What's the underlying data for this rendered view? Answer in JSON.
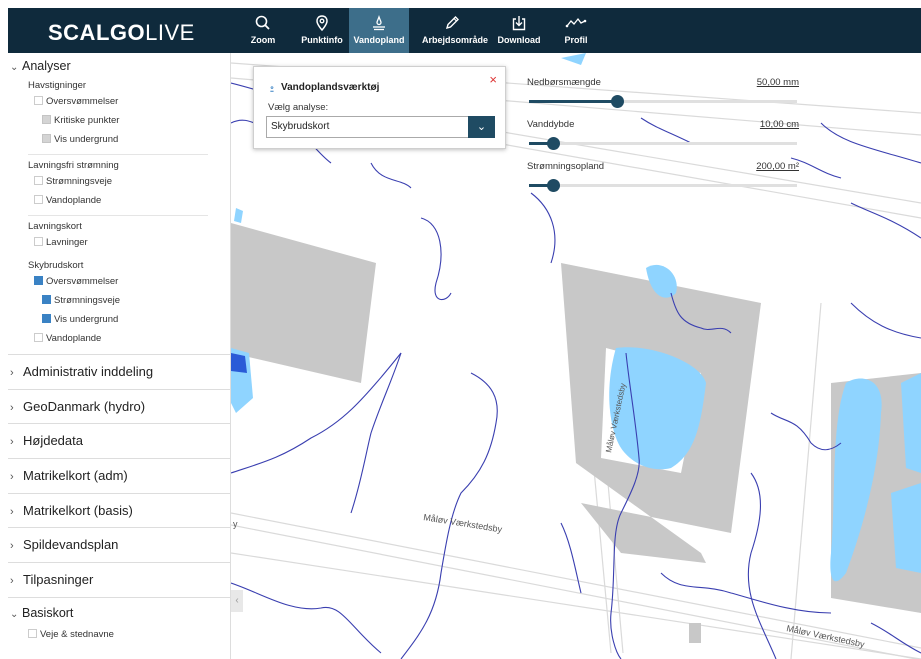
{
  "app": {
    "logo_bold": "SCALGO",
    "logo_light": "LIVE"
  },
  "toolbar": [
    {
      "label": "Zoom",
      "icon": "search-icon"
    },
    {
      "label": "Punktinfo",
      "icon": "map-pin-icon"
    },
    {
      "label": "Vandopland",
      "icon": "water-drop-icon",
      "active": true
    },
    {
      "label": "Arbejdsområde",
      "icon": "pencil-icon"
    },
    {
      "label": "Download",
      "icon": "download-icon"
    },
    {
      "label": "Profil",
      "icon": "profile-icon"
    }
  ],
  "sidebar": {
    "open_section": "Analyser",
    "groups": [
      {
        "title": "Havstigninger",
        "items": [
          {
            "label": "Oversvømmelser",
            "state": "empty",
            "indent": false
          },
          {
            "label": "Kritiske punkter",
            "state": "grey",
            "indent": true
          },
          {
            "label": "Vis undergrund",
            "state": "grey",
            "indent": true
          }
        ]
      },
      {
        "title": "Lavningsfri strømning",
        "items": [
          {
            "label": "Strømningsveje",
            "state": "empty",
            "indent": false
          },
          {
            "label": "Vandoplande",
            "state": "empty",
            "indent": false
          }
        ]
      },
      {
        "title": "Lavningskort",
        "items": [
          {
            "label": "Lavninger",
            "state": "empty",
            "indent": false
          }
        ]
      },
      {
        "title": "Skybrudskort",
        "items": [
          {
            "label": "Oversvømmelser",
            "state": "blue",
            "indent": false
          },
          {
            "label": "Strømningsveje",
            "state": "blue",
            "indent": true
          },
          {
            "label": "Vis undergrund",
            "state": "blue",
            "indent": true
          },
          {
            "label": "Vandoplande",
            "state": "empty",
            "indent": false
          }
        ]
      }
    ],
    "closed_sections": [
      "Administrativ inddeling",
      "GeoDanmark (hydro)",
      "Højdedata",
      "Matrikelkort (adm)",
      "Matrikelkort (basis)",
      "Spildevandsplan",
      "Tilpasninger"
    ],
    "basiskort": {
      "title": "Basiskort",
      "items": [
        {
          "label": "Veje & stednavne",
          "state": "empty"
        }
      ]
    }
  },
  "panel": {
    "title": "Vandoplandsværktøj",
    "close": "×",
    "select_label": "Vælg analyse:",
    "select_value": "Skybrudskort"
  },
  "sliders": [
    {
      "label": "Nedbørsmængde",
      "value": "50,00 mm",
      "fraction": 0.33
    },
    {
      "label": "Vanddybde",
      "value": "10,00 cm",
      "fraction": 0.09
    },
    {
      "label": "Strømningsopland",
      "value": "200,00 m²",
      "fraction": 0.09
    }
  ],
  "map": {
    "street_labels": [
      "Måløv Værkstedsby",
      "Måløv Værkstedsby",
      "Måløv Værkstedsby"
    ],
    "colors": {
      "flood": "#8fd4ff",
      "flowline": "#3a3fb0",
      "building": "#c8c8c8",
      "road": "#d9d9d9"
    }
  }
}
